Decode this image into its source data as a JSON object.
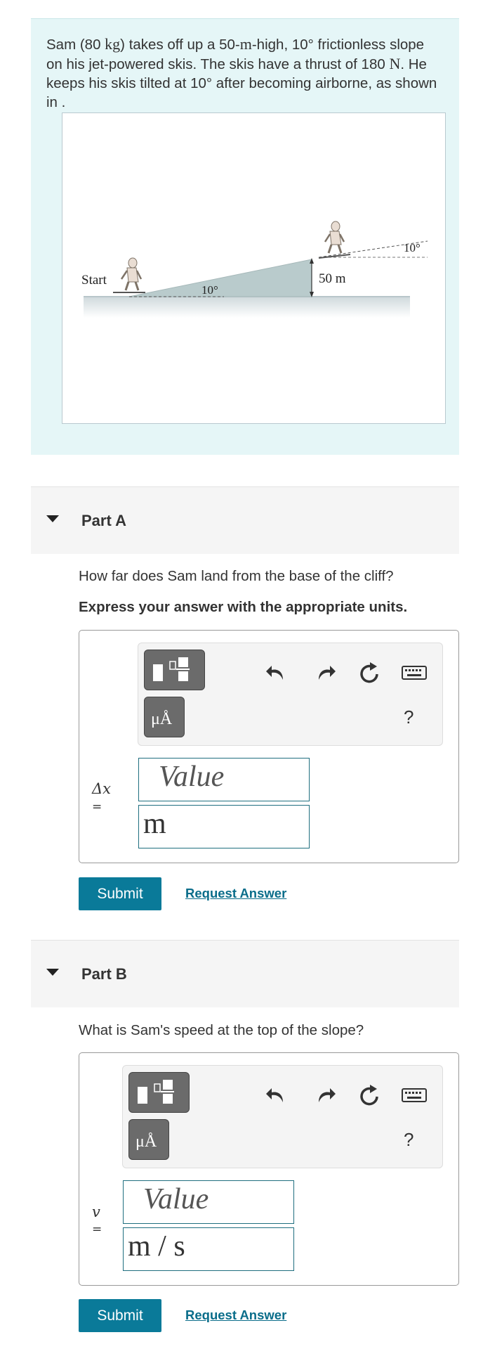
{
  "problem": {
    "text_parts": {
      "a": "Sam (80 ",
      "b": "kg",
      "c": ") takes off up a 50-",
      "d": "m",
      "e": "-high, 10",
      "f": "°",
      "g": " frictionless slope on his jet-powered skis. The skis have a thrust of 180 ",
      "h": "N",
      "i": ". He keeps his skis tilted at 10",
      "j": "°",
      "k": " after becoming airborne, as shown in ."
    },
    "figure": {
      "start_label": "Start",
      "slope_angle_label": "10°",
      "height_label": "50 m",
      "tilt_angle_label": "10°"
    }
  },
  "part_a": {
    "title": "Part A",
    "question": "How far does Sam land from the base of the cliff?",
    "instruction": "Express your answer with the appropriate units.",
    "variable": "Δx",
    "equals": "=",
    "value_placeholder": "Value",
    "unit_value": "m",
    "help": "?",
    "submit_label": "Submit",
    "request_label": "Request Answer"
  },
  "part_b": {
    "title": "Part B",
    "question": "What is Sam's speed at the top of the slope?",
    "variable": "v",
    "equals": "=",
    "value_placeholder": "Value",
    "unit_value": "m / s",
    "help": "?",
    "submit_label": "Submit",
    "request_label": "Request Answer"
  },
  "toolbar": {
    "units_button_glyph": "μÅ",
    "icons": [
      "templates-icon",
      "units-icon",
      "undo-icon",
      "redo-icon",
      "reset-icon",
      "keyboard-icon",
      "help-icon"
    ]
  },
  "colors": {
    "problem_bg": "#e5f6f7",
    "accent": "#0a7a99",
    "link": "#0a6d8a",
    "field_border": "#1f6e7f"
  }
}
